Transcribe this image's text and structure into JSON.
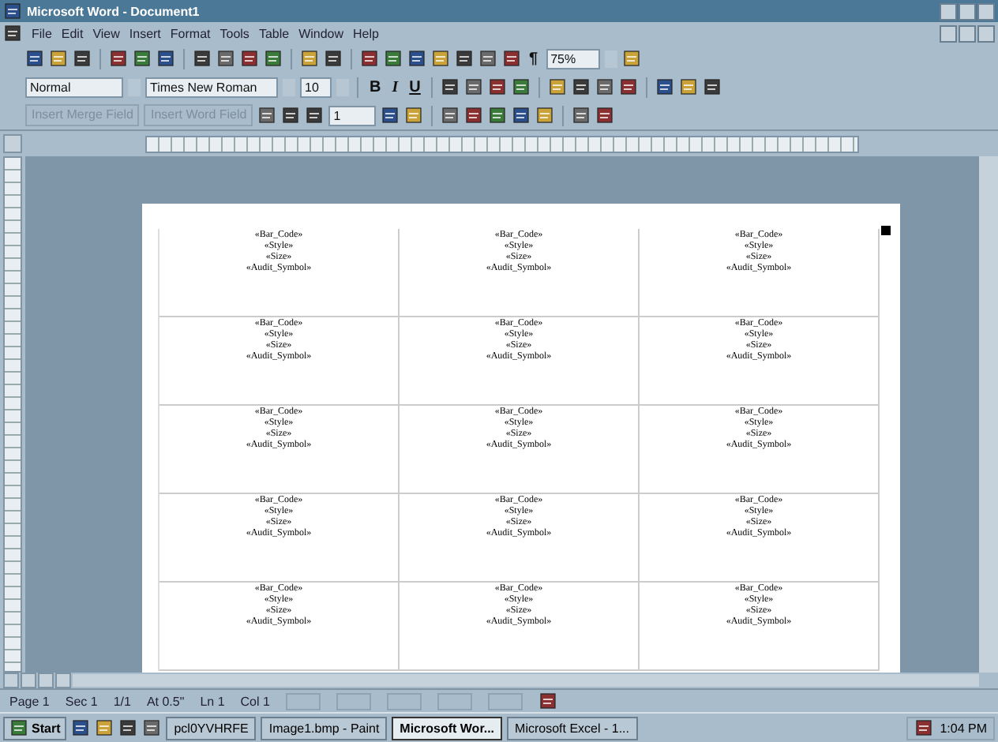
{
  "window": {
    "title": "Microsoft Word - Document1"
  },
  "menu": [
    {
      "label": "File"
    },
    {
      "label": "Edit"
    },
    {
      "label": "View"
    },
    {
      "label": "Insert"
    },
    {
      "label": "Format"
    },
    {
      "label": "Tools"
    },
    {
      "label": "Table"
    },
    {
      "label": "Window"
    },
    {
      "label": "Help"
    }
  ],
  "standard_toolbar": {
    "show_hide": "¶",
    "zoom": "75%"
  },
  "formatting_toolbar": {
    "style": "Normal",
    "font": "Times New Roman",
    "size": "10",
    "bold": "B",
    "italic": "I",
    "underline": "U"
  },
  "mail_merge_toolbar": {
    "merge_field": "Insert Merge Field",
    "word_field": "Insert Word Field",
    "record": "1"
  },
  "labels": {
    "rows": [
      [
        {
          "lines": [
            "«Bar_Code»",
            "«Style»",
            "«Size»",
            "«Audit_Symbol»"
          ]
        },
        {
          "lines": [
            "«Bar_Code»",
            "«Style»",
            "«Size»",
            "«Audit_Symbol»"
          ]
        },
        {
          "lines": [
            "«Bar_Code»",
            "«Style»",
            "«Size»",
            "«Audit_Symbol»"
          ]
        }
      ],
      [
        {
          "lines": [
            "«Bar_Code»",
            "«Style»",
            "«Size»",
            "«Audit_Symbol»"
          ]
        },
        {
          "lines": [
            "«Bar_Code»",
            "«Style»",
            "«Size»",
            "«Audit_Symbol»"
          ]
        },
        {
          "lines": [
            "«Bar_Code»",
            "«Style»",
            "«Size»",
            "«Audit_Symbol»"
          ]
        }
      ],
      [
        {
          "lines": [
            "«Bar_Code»",
            "«Style»",
            "«Size»",
            "«Audit_Symbol»"
          ]
        },
        {
          "lines": [
            "«Bar_Code»",
            "«Style»",
            "«Size»",
            "«Audit_Symbol»"
          ]
        },
        {
          "lines": [
            "«Bar_Code»",
            "«Style»",
            "«Size»",
            "«Audit_Symbol»"
          ]
        }
      ],
      [
        {
          "lines": [
            "«Bar_Code»",
            "«Style»",
            "«Size»",
            "«Audit_Symbol»"
          ]
        },
        {
          "lines": [
            "«Bar_Code»",
            "«Style»",
            "«Size»",
            "«Audit_Symbol»"
          ]
        },
        {
          "lines": [
            "«Bar_Code»",
            "«Style»",
            "«Size»",
            "«Audit_Symbol»"
          ]
        }
      ],
      [
        {
          "lines": [
            "«Bar_Code»",
            "«Style»",
            "«Size»",
            "«Audit_Symbol»"
          ]
        },
        {
          "lines": [
            "«Bar_Code»",
            "«Style»",
            "«Size»",
            "«Audit_Symbol»"
          ]
        },
        {
          "lines": [
            "«Bar_Code»",
            "«Style»",
            "«Size»",
            "«Audit_Symbol»"
          ]
        }
      ]
    ]
  },
  "status_bar": [
    {
      "text": "Page 1"
    },
    {
      "text": "Sec 1"
    },
    {
      "text": "1/1"
    },
    {
      "text": "At 0.5\""
    },
    {
      "text": "Ln 1"
    },
    {
      "text": "Col 1"
    }
  ],
  "taskbar": {
    "start": "Start",
    "tasks": [
      {
        "label": "pcl0YVHRFE",
        "selected": false
      },
      {
        "label": "Image1.bmp - Paint",
        "selected": false
      },
      {
        "label": "Microsoft Wor...",
        "selected": true
      },
      {
        "label": "Microsoft Excel - 1...",
        "selected": false
      }
    ],
    "clock": "1:04 PM"
  }
}
